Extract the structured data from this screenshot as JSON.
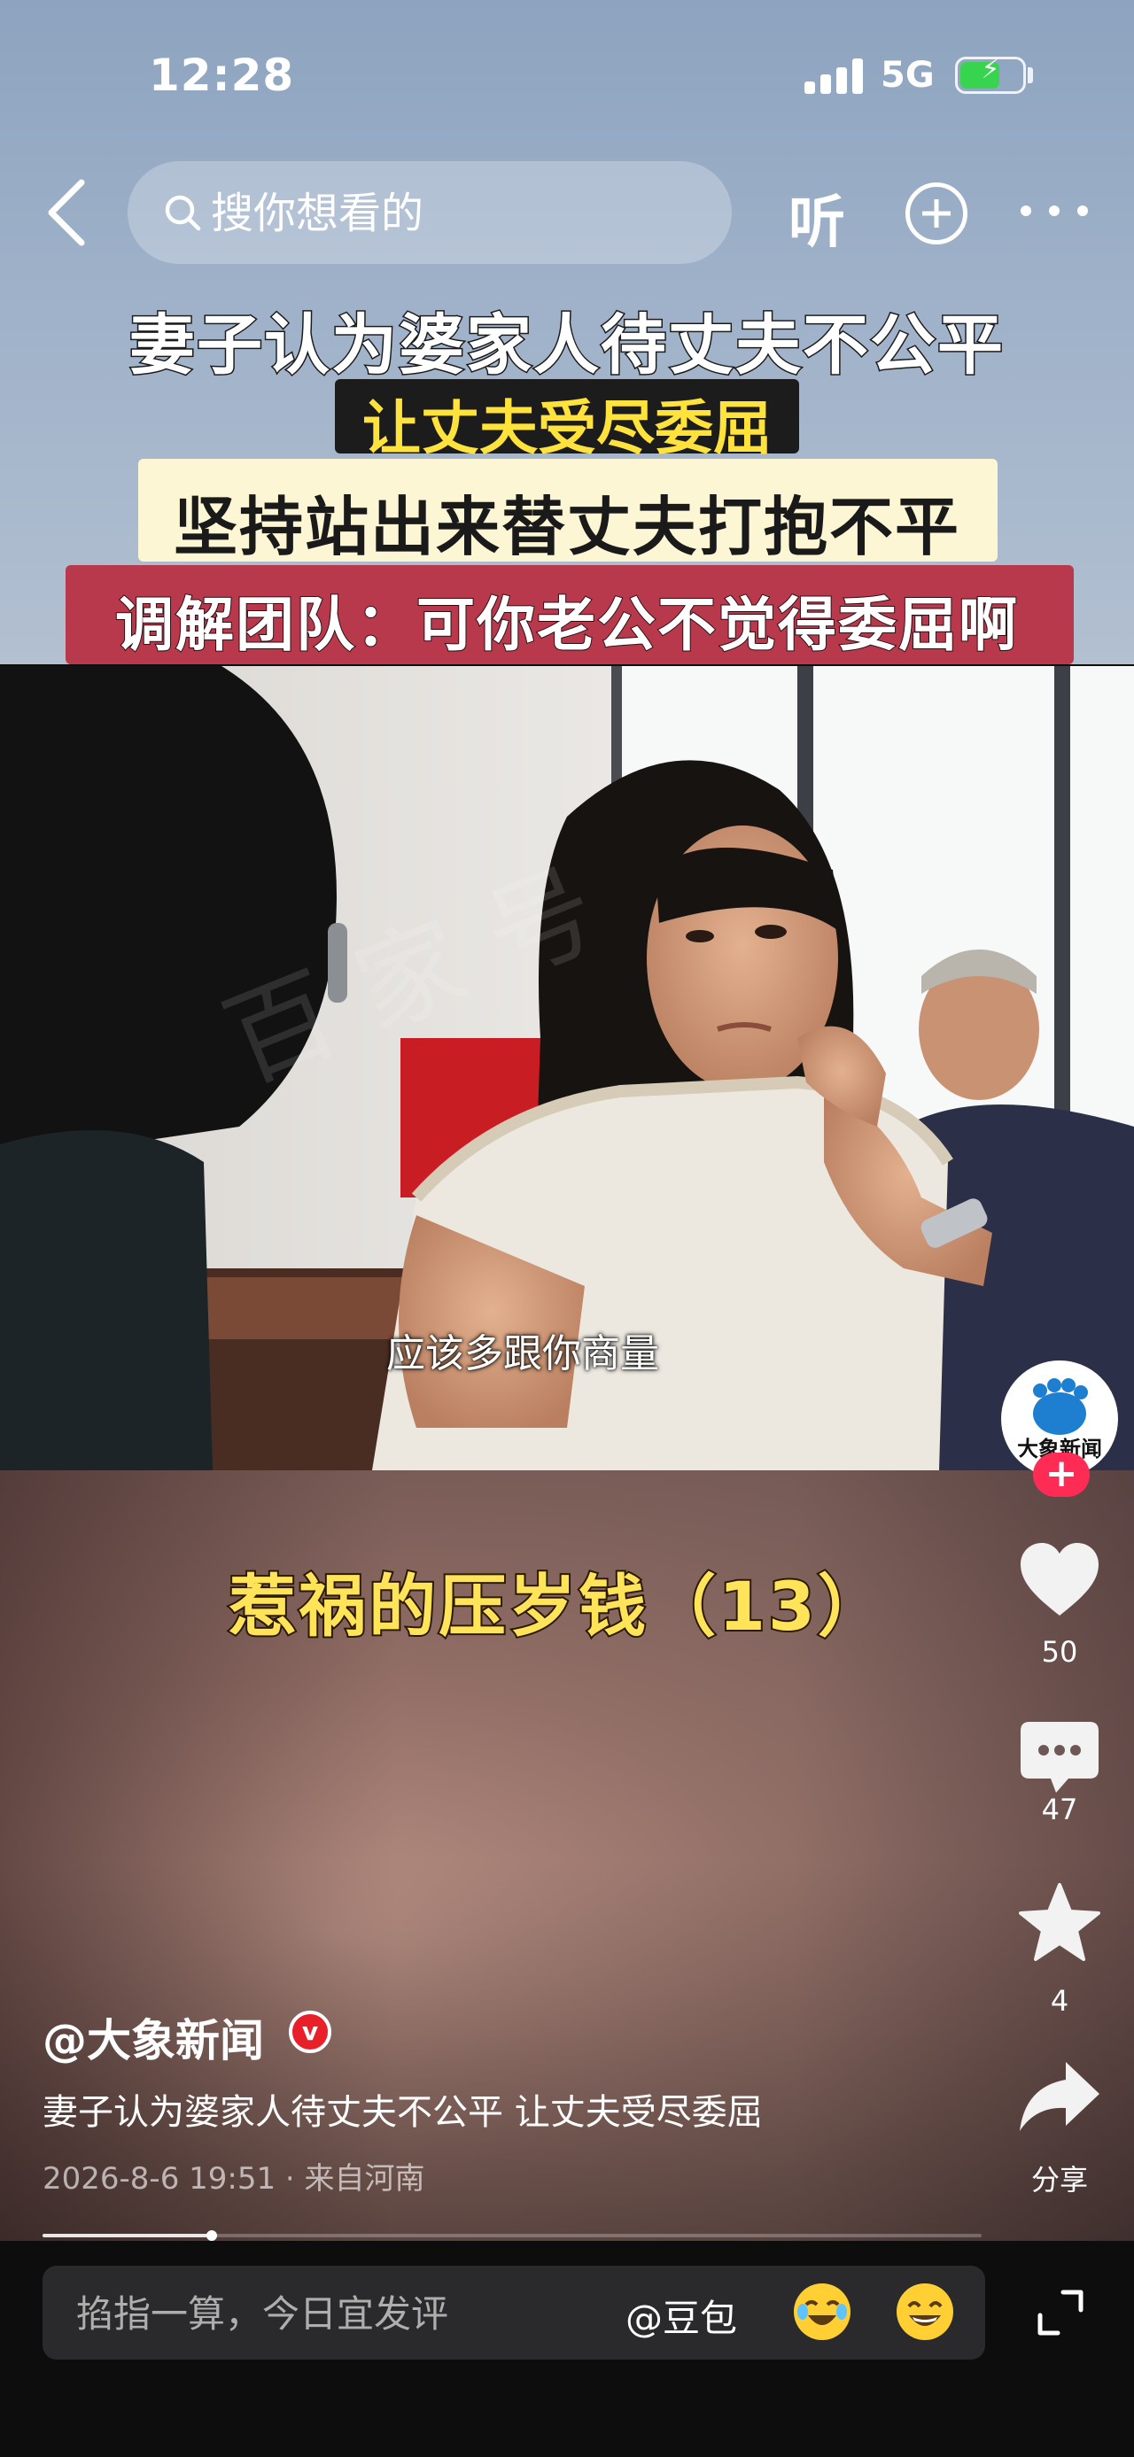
{
  "status_bar": {
    "time": "12:28",
    "network": "5G",
    "battery_level": 0.65,
    "battery_charging": true,
    "signal_bars": 4
  },
  "top_bar": {
    "search_placeholder": "搜你想看的",
    "listen_label": "听",
    "icons": [
      "back-arrow-icon",
      "search-icon",
      "plus-circle-icon",
      "more-dots-icon"
    ]
  },
  "headlines": {
    "line1": "妻子认为婆家人待丈夫不公平",
    "line2": "让丈夫受尽委屈",
    "line3": "坚持站出来替丈夫打抱不平",
    "line4": "调解团队：可你老公不觉得委屈啊"
  },
  "video": {
    "subtitle": "应该多跟你商量",
    "episode_title": "惹祸的压岁钱（13）",
    "progress": 0.18
  },
  "actions": {
    "avatar_text": "大象新闻",
    "likes": "50",
    "comments": "47",
    "favorites": "4",
    "share_label": "分享"
  },
  "caption": {
    "author": "@大象新闻",
    "verified_mark": "v",
    "description": "妻子认为婆家人待丈夫不公平 让丈夫受尽委屈",
    "meta": "2026-8-6 19:51 · 来自河南"
  },
  "comment_bar": {
    "placeholder": "掐指一算，今日宜发评",
    "mention": "@豆包"
  },
  "colors": {
    "accent_red": "#fe2c55",
    "headline_yellow": "#ffe23c",
    "banner_red": "#b8384c",
    "episode_yellow": "#ffe45a"
  }
}
